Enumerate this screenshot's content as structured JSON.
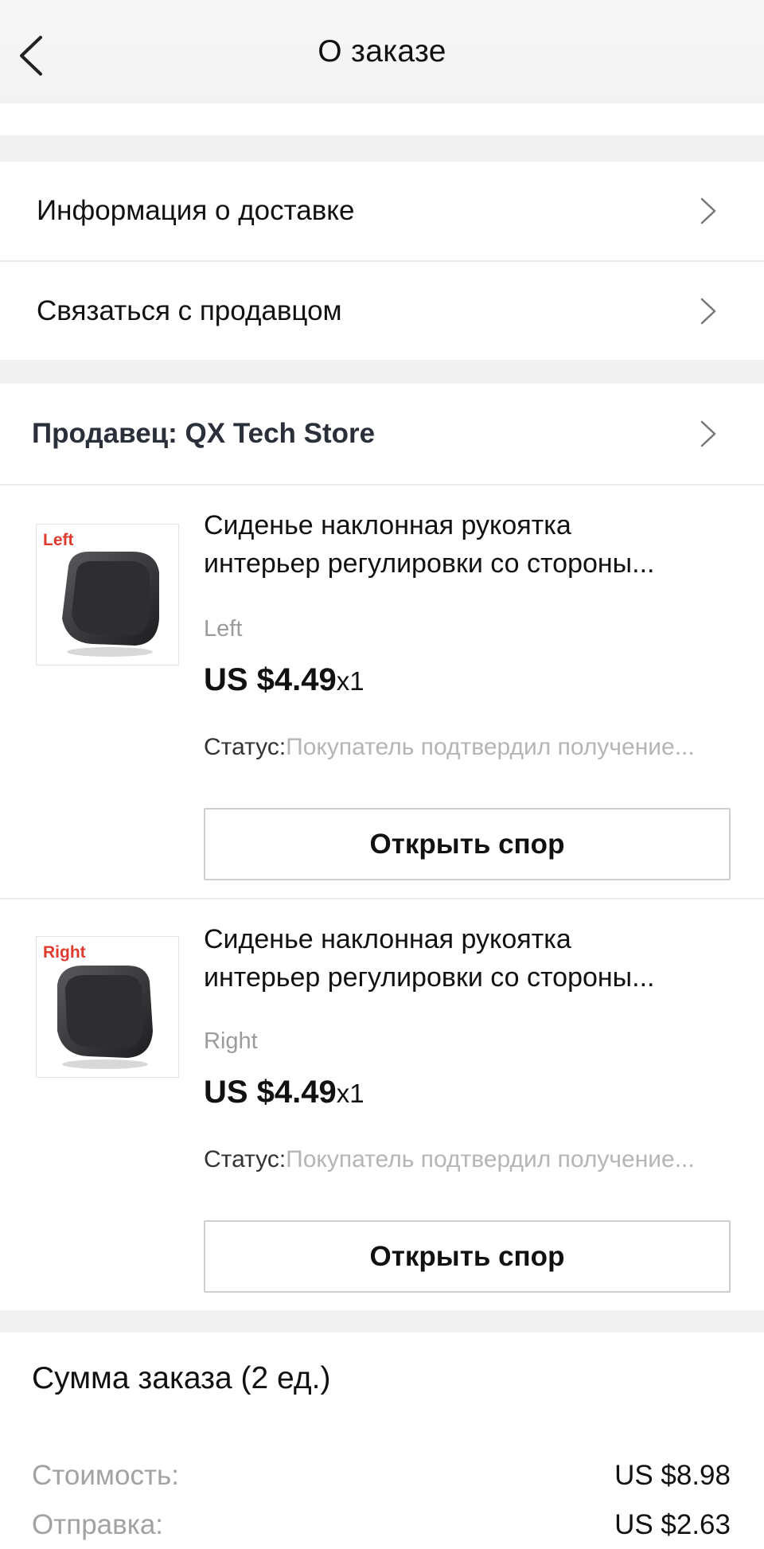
{
  "header": {
    "title": "О заказе",
    "back_icon": "chevron-left-icon"
  },
  "menu": {
    "delivery_info": "Информация о доставке",
    "contact_seller": "Связаться с продавцом"
  },
  "seller": {
    "label": "Продавец: QX Tech Store"
  },
  "products": [
    {
      "thumb_tag": "Left",
      "title_line1": "Сиденье наклонная рукоятка",
      "title_line2": "интерьер регулировки со стороны...",
      "variant": "Left",
      "price": "US $4.49",
      "qty": "x1",
      "status_label": "Статус:",
      "status_value": "Покупатель подтвердил получение...",
      "dispute_label": "Открыть спор"
    },
    {
      "thumb_tag": "Right",
      "title_line1": "Сиденье наклонная рукоятка",
      "title_line2": "интерьер регулировки со стороны...",
      "variant": "Right",
      "price": "US $4.49",
      "qty": "x1",
      "status_label": "Статус:",
      "status_value": "Покупатель подтвердил получение...",
      "dispute_label": "Открыть спор"
    }
  ],
  "summary": {
    "title": "Сумма заказа (2 ед.)",
    "cost_label": "Стоимость:",
    "cost_value": "US $8.98",
    "shipping_label": "Отправка:",
    "shipping_value": "US $2.63"
  },
  "colors": {
    "background_gap": "#f1f1f1",
    "thumb_tag": "#e03a2f",
    "muted_text": "#9b9b9b",
    "status_value": "#b5b5b5"
  }
}
